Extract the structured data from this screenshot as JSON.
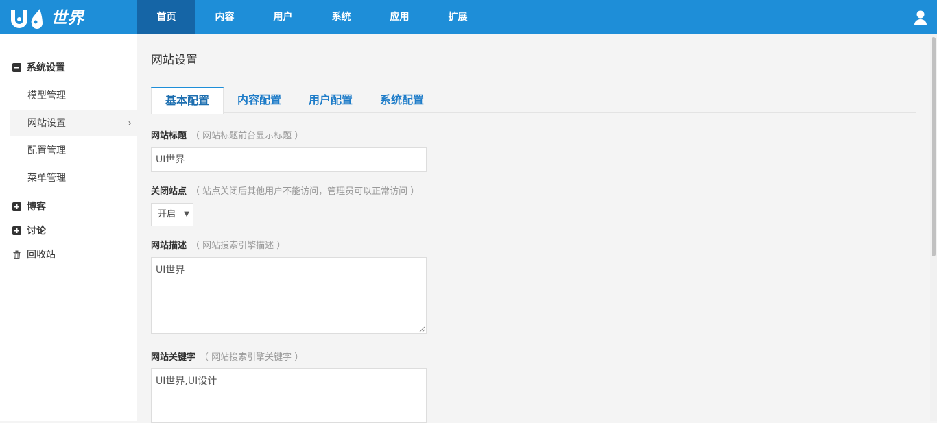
{
  "brand": {
    "logo_text": "世界",
    "logo_color": "#ffffff"
  },
  "topnav": {
    "items": [
      {
        "label": "首页",
        "active": true
      },
      {
        "label": "内容",
        "active": false
      },
      {
        "label": "用户",
        "active": false
      },
      {
        "label": "系统",
        "active": false
      },
      {
        "label": "应用",
        "active": false
      },
      {
        "label": "扩展",
        "active": false
      }
    ],
    "user_icon": "user-icon"
  },
  "sidebar": {
    "group_system": {
      "label": "系统设置",
      "icon": "minus-square-icon"
    },
    "items": [
      {
        "label": "模型管理"
      },
      {
        "label": "网站设置",
        "active": true
      },
      {
        "label": "配置管理"
      },
      {
        "label": "菜单管理"
      }
    ],
    "group_blog": {
      "label": "博客",
      "icon": "plus-square-icon"
    },
    "group_discuss": {
      "label": "讨论",
      "icon": "plus-square-icon"
    },
    "group_trash": {
      "label": "回收站",
      "icon": "trash-icon"
    }
  },
  "main": {
    "title": "网站设置",
    "tabs": [
      {
        "label": "基本配置",
        "active": true
      },
      {
        "label": "内容配置"
      },
      {
        "label": "用户配置"
      },
      {
        "label": "系统配置"
      }
    ],
    "fields": {
      "site_title": {
        "label": "网站标题",
        "hint": "（ 网站标题前台显示标题 ）",
        "value": "UI世界"
      },
      "close_site": {
        "label": "关闭站点",
        "hint": "（ 站点关闭后其他用户不能访问，管理员可以正常访问 ）",
        "value": "开启"
      },
      "site_desc": {
        "label": "网站描述",
        "hint": "（ 网站搜索引擎描述 ）",
        "value": "UI世界"
      },
      "site_keywords": {
        "label": "网站关键字",
        "hint": "（ 网站搜索引擎关键字 ）",
        "value": "UI世界,UI设计"
      }
    }
  },
  "colors": {
    "topbar": "#1e8ed8",
    "nav_active": "#1565a6",
    "tab_text": "#1e7cc8"
  }
}
